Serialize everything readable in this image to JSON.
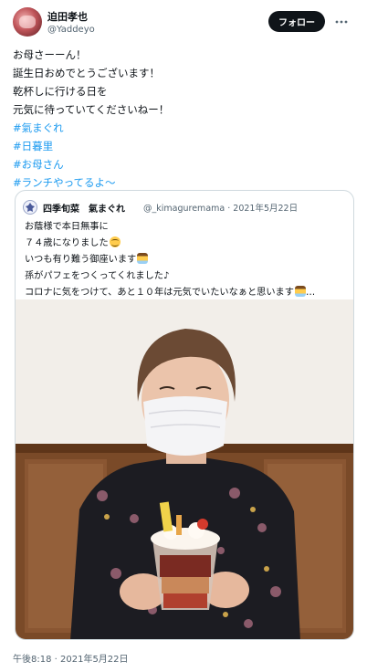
{
  "author": {
    "name": "迫田孝也",
    "handle": "@Yaddeyo",
    "avatar_icon": "profile-photo"
  },
  "actions": {
    "follow_label": "フォロー",
    "more_icon": "more-dots-icon"
  },
  "tweet": {
    "lines": [
      "お母さーーん！",
      "誕生日おめでとうございます！",
      "乾杯しに行ける日を",
      "元気に待っていてくださいねー！"
    ],
    "hashtags": [
      "#氣まぐれ",
      "#日暮里",
      "#お母さん",
      "#ランチやってるよ〜"
    ]
  },
  "quote": {
    "name": "四季旬菜　氣まぐれ",
    "handle_date": "@_kimaguremama · 2021年5月22日",
    "lines": [
      "お蔭様で本日無事に",
      "７４歳になりました",
      "いつも有り難う御座います",
      "孫がパフェをつくってくれました♪",
      "コロナに気をつけて、あと１０年は元気でいたいなぁと思います"
    ],
    "truncation": "…",
    "emoji": [
      "smiling-face-emoji",
      "person-bowing-emoji"
    ]
  },
  "timestamp": "午後8:18 · 2021年5月22日",
  "colors": {
    "link": "#1d9bf0",
    "text": "#0f1419",
    "muted": "#536471",
    "border": "#cfd9de",
    "button_bg": "#0f1419"
  }
}
